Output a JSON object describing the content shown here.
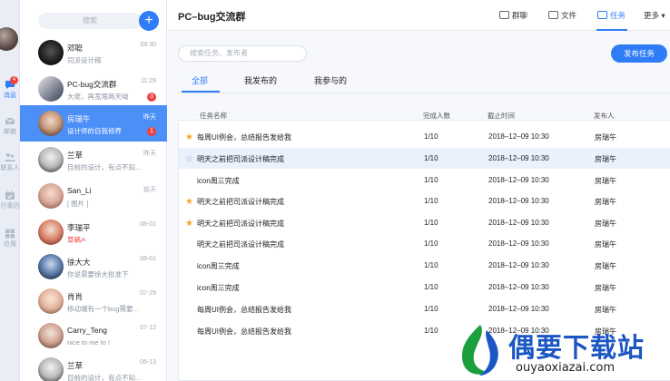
{
  "sidebar": {
    "items": [
      {
        "label": "消息",
        "badge": "4",
        "icon": "chat-icon",
        "active": true
      },
      {
        "label": "邮箱",
        "icon": "mail-icon"
      },
      {
        "label": "联系人",
        "icon": "contacts-icon"
      },
      {
        "label": "行事历",
        "icon": "calendar-icon"
      },
      {
        "label": "应用",
        "icon": "apps-icon"
      }
    ]
  },
  "conv_list": {
    "search_placeholder": "搜索",
    "add_label": "+",
    "items": [
      {
        "name": "邓聪",
        "preview": "司派设计稿",
        "time": "09:30"
      },
      {
        "name": "PC-bug交流群",
        "preview": "大佬，再宽限两天呦",
        "time": "11:29",
        "badge": "3"
      },
      {
        "name": "房瑞午",
        "preview": "设计师的自我修养",
        "time": "昨天",
        "badge": "1",
        "active": true
      },
      {
        "name": "兰草",
        "preview": "目前的设计，有点不知...",
        "time": "昨天"
      },
      {
        "name": "San_Li",
        "preview": "[ 图片 ]",
        "time": "前天"
      },
      {
        "name": "李瑞平",
        "preview_draft": "草稿",
        "preview_icon": "✍",
        "time": "08-01"
      },
      {
        "name": "徐大大",
        "preview": "你说需要徐大批准下",
        "time": "08-01"
      },
      {
        "name": "肖肖",
        "preview": "移动端有一个bug需要...",
        "time": "07-29"
      },
      {
        "name": "Carry_Teng",
        "preview": "nice to me to !",
        "time": "07-12"
      },
      {
        "name": "兰草",
        "preview": "目前的设计，有点不知...",
        "time": "06-13"
      }
    ]
  },
  "header": {
    "title": "PC–bug交流群",
    "buttons": [
      {
        "label": "群聊",
        "icon": "chat-bubble-icon"
      },
      {
        "label": "文件",
        "icon": "folder-icon"
      },
      {
        "label": "任务",
        "icon": "task-icon",
        "active": true
      },
      {
        "label": "更多 ▾",
        "icon": "more-icon"
      }
    ]
  },
  "tasks": {
    "search_placeholder": "搜索任务、发布者",
    "publish_label": "发布任务",
    "tabs": [
      "全部",
      "我发布的",
      "我参与的"
    ],
    "columns": [
      "任务名称",
      "完成人数",
      "截止时间",
      "发布人"
    ],
    "rows": [
      {
        "star": "on",
        "name": "每周UI例会，总结报告发给我",
        "done": "1/10",
        "deadline": "2018–12–09  10:30",
        "publisher": "房瑞午"
      },
      {
        "star": "off",
        "name": "明天之前把司派设计稿完成",
        "done": "1/10",
        "deadline": "2018–12–09  10:30",
        "publisher": "房瑞午",
        "highlight": true
      },
      {
        "star": "",
        "name": "icon周三完成",
        "done": "1/10",
        "deadline": "2018–12–09  10:30",
        "publisher": "房瑞午"
      },
      {
        "star": "on",
        "name": "明天之前把司派设计稿完成",
        "done": "1/10",
        "deadline": "2018–12–09  10:30",
        "publisher": "房瑞午"
      },
      {
        "star": "on",
        "name": "明天之前把司派设计稿完成",
        "done": "1/10",
        "deadline": "2018–12–09  10:30",
        "publisher": "房瑞午"
      },
      {
        "star": "",
        "name": "明天之前把司派设计稿完成",
        "done": "1/10",
        "deadline": "2018–12–09  10:30",
        "publisher": "房瑞午"
      },
      {
        "star": "",
        "name": "icon周三完成",
        "done": "1/10",
        "deadline": "2018–12–09  10:30",
        "publisher": "房瑞午"
      },
      {
        "star": "",
        "name": "icon周三完成",
        "done": "1/10",
        "deadline": "2018–12–09  10:30",
        "publisher": "房瑞午"
      },
      {
        "star": "",
        "name": "每周UI例会，总结报告发给我",
        "done": "1/10",
        "deadline": "2018–12–09  10:30",
        "publisher": "房瑞午"
      },
      {
        "star": "",
        "name": "每周UI例会，总结报告发给我",
        "done": "1/10",
        "deadline": "2018–12–09  10:30",
        "publisher": "房瑞午"
      }
    ]
  },
  "watermark": {
    "text": "偶要下载站",
    "url": "ouyaoxiazai.com"
  },
  "colors": {
    "accent": "#2e7cf6",
    "badge": "#f04040",
    "star": "#f5a623"
  }
}
